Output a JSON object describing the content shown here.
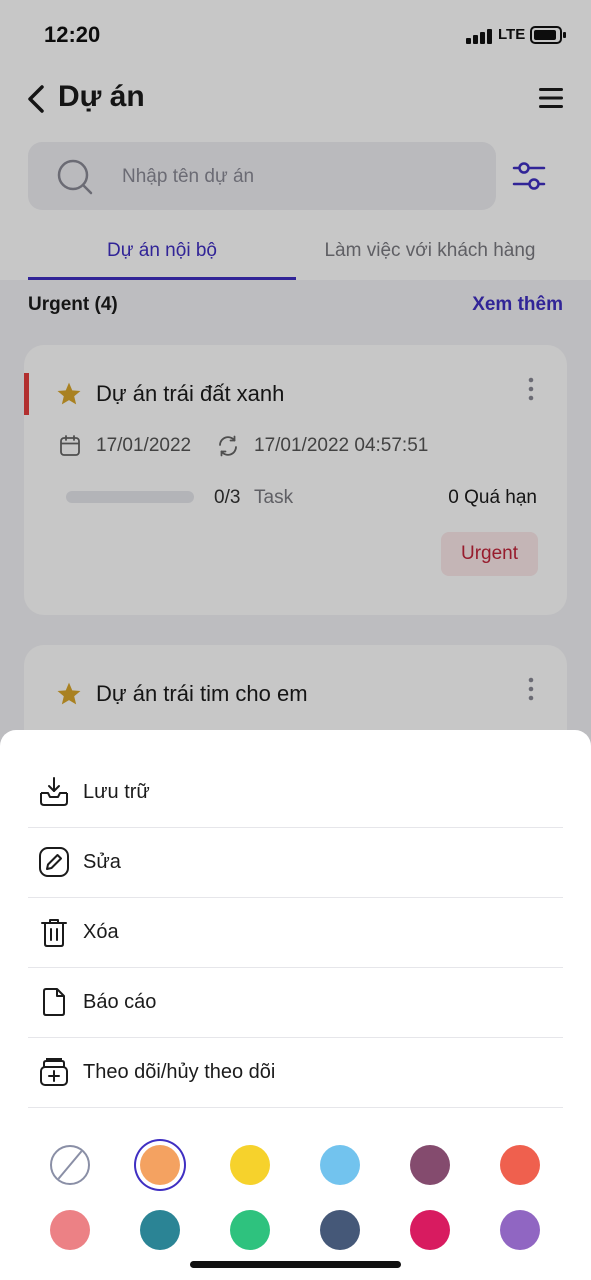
{
  "status_bar": {
    "time": "12:20",
    "network": "LTE"
  },
  "header": {
    "title": "Dự án"
  },
  "search": {
    "placeholder": "Nhập tên dự án"
  },
  "tabs": [
    {
      "label": "Dự án nội bộ",
      "active": true
    },
    {
      "label": "Làm việc với khách hàng",
      "active": false
    }
  ],
  "section": {
    "title": "Urgent (4)",
    "more": "Xem thêm"
  },
  "projects": [
    {
      "name": "Dự án trái đất xanh",
      "start_date": "17/01/2022",
      "updated": "17/01/2022 04:57:51",
      "task_count": "0/3",
      "task_label": "Task",
      "overdue": "0 Quá hạn",
      "badge": "Urgent",
      "progress": 0
    },
    {
      "name": "Dự án trái tim cho em"
    }
  ],
  "sheet": {
    "actions": [
      {
        "label": "Lưu trữ",
        "icon": "archive-icon"
      },
      {
        "label": "Sửa",
        "icon": "edit-icon"
      },
      {
        "label": "Xóa",
        "icon": "trash-icon"
      },
      {
        "label": "Báo cáo",
        "icon": "report-icon"
      },
      {
        "label": "Theo dõi/hủy theo dõi",
        "icon": "follow-icon"
      }
    ],
    "colors": [
      "none",
      "#f4a261",
      "#f6d22c",
      "#72c3ee",
      "#844b6e",
      "#ef604e",
      "#ec8185",
      "#2b8495",
      "#2ec27e",
      "#455878",
      "#d81b60",
      "#9066c2"
    ],
    "selected_color": "#f4a261"
  },
  "theme": {
    "accent": "#3f2fc2",
    "urgent": "#e43d3d",
    "star": "#d9a62b"
  }
}
